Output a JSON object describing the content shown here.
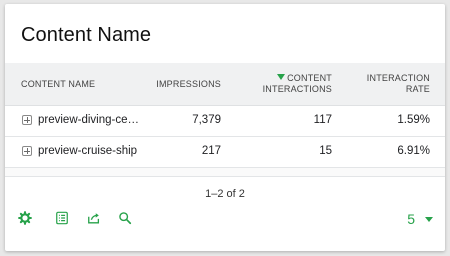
{
  "widget": {
    "title": "Content Name",
    "accent_color": "#27a24a"
  },
  "table": {
    "columns": {
      "name": "CONTENT NAME",
      "impressions": "IMPRESSIONS",
      "content_interactions": "CONTENT INTERACTIONS",
      "interaction_rate": "INTERACTION RATE"
    },
    "sorted_column": "content_interactions",
    "sort_direction": "descending",
    "rows": [
      {
        "name": "preview-diving-ce…",
        "impressions": "7,379",
        "content_interactions": "117",
        "interaction_rate": "1.59%"
      },
      {
        "name": "preview-cruise-ship",
        "impressions": "217",
        "content_interactions": "15",
        "interaction_rate": "6.91%"
      }
    ]
  },
  "pagination": {
    "label": "1–2 of 2",
    "page_size": "5"
  },
  "toolbar": {
    "icons": [
      "gear-icon",
      "table-view-icon",
      "export-icon",
      "search-icon"
    ]
  }
}
